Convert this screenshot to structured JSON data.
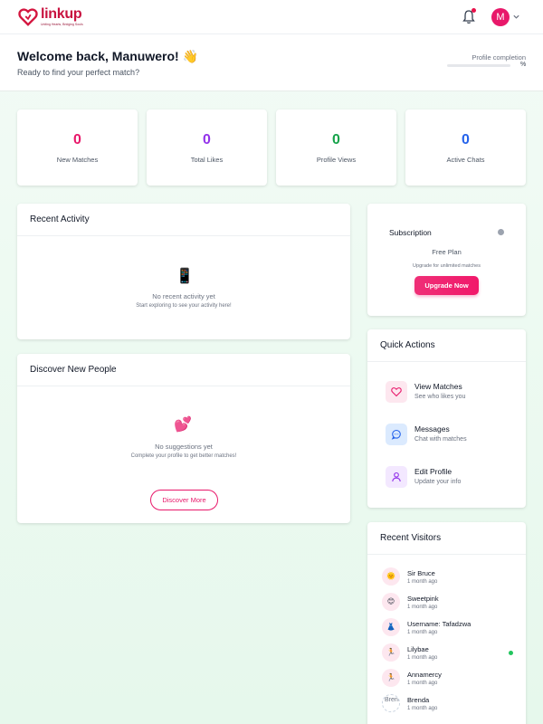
{
  "brand": {
    "name": "linkup",
    "tagline": "Uniting Hearts, Bridging Souls",
    "primary_color": "#e8186a"
  },
  "header": {
    "notification_icon": "bell-icon",
    "has_notification": true,
    "user_initial": "M",
    "user_menu_icon": "chevron-down-icon"
  },
  "welcome": {
    "title": "Welcome back, Manuwero! 👋",
    "subtitle": "Ready to find your perfect match?",
    "profile_completion_label": "Profile completion",
    "profile_completion_value": "%",
    "profile_completion_fraction": 0
  },
  "stats": [
    {
      "value": "0",
      "label": "New Matches",
      "color": "#e8186a"
    },
    {
      "value": "0",
      "label": "Total Likes",
      "color": "#9333ea"
    },
    {
      "value": "0",
      "label": "Profile Views",
      "color": "#16a34a"
    },
    {
      "value": "0",
      "label": "Active Chats",
      "color": "#2563eb"
    }
  ],
  "recent_activity": {
    "title": "Recent Activity",
    "icon": "📱",
    "empty_title": "No recent activity yet",
    "empty_subtitle": "Start exploring to see your activity here!"
  },
  "discover": {
    "title": "Discover New People",
    "icon": "💕",
    "empty_title": "No suggestions yet",
    "empty_subtitle": "Complete your profile to get better matches!",
    "button_label": "Discover More"
  },
  "subscription": {
    "title": "Subscription",
    "plan": "Free Plan",
    "upgrade_text": "Upgrade for unlimited matches",
    "button_label": "Upgrade Now"
  },
  "quick_actions": {
    "title": "Quick Actions",
    "items": [
      {
        "label": "View Matches",
        "desc": "See who likes you",
        "icon": "heart-icon"
      },
      {
        "label": "Messages",
        "desc": "Chat with matches",
        "icon": "chat-bubble-icon"
      },
      {
        "label": "Edit Profile",
        "desc": "Update your info",
        "icon": "user-icon"
      }
    ]
  },
  "recent_visitors": {
    "title": "Recent Visitors",
    "items": [
      {
        "name": "Sir Bruce",
        "time": "1 month ago",
        "avatar": "🌞"
      },
      {
        "name": "Sweetpink",
        "time": "1 month ago",
        "avatar": "😊"
      },
      {
        "name": "Username: Tafadzwa",
        "time": "1 month ago",
        "avatar": "👗"
      },
      {
        "name": "Lilybae",
        "time": "1 month ago",
        "avatar": "🏃",
        "online": true
      },
      {
        "name": "Annamercy",
        "time": "1 month ago",
        "avatar": "🏃"
      },
      {
        "name": "Brenda",
        "time": "1 month ago",
        "avatar_alt": "Brenda"
      }
    ]
  }
}
